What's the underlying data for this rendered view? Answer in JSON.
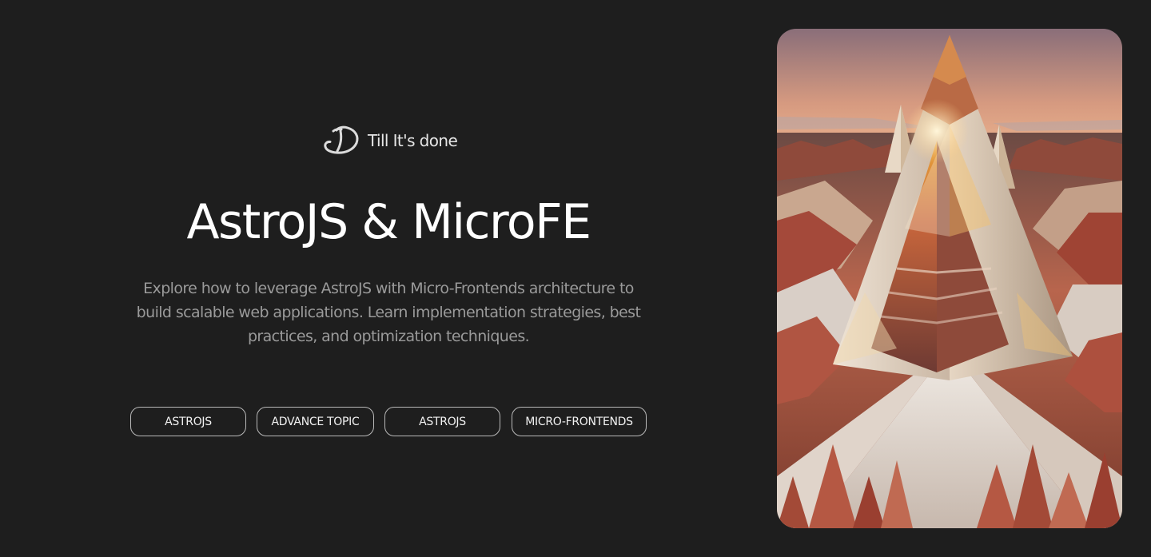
{
  "brand": {
    "name": "Till It's done",
    "logo_icon": "signature-d-logo-icon"
  },
  "hero": {
    "title": "AstroJS & MicroFE",
    "description": "Explore how to leverage AstroJS with Micro-Frontends architecture to build scalable web applications. Learn implementation strategies, best practices, and optimization techniques.",
    "image_subject": "crystal-pyramid-desert-artwork"
  },
  "tags": [
    {
      "label": "ASTROJS"
    },
    {
      "label": "ADVANCE TOPIC"
    },
    {
      "label": "ASTROJS"
    },
    {
      "label": "MICRO-FRONTENDS"
    }
  ],
  "colors": {
    "background": "#1e1e1e",
    "title": "#ffffff",
    "description": "#9a9a9a",
    "tag_border": "#b9b9b9",
    "tag_text": "#f2f2f2"
  }
}
